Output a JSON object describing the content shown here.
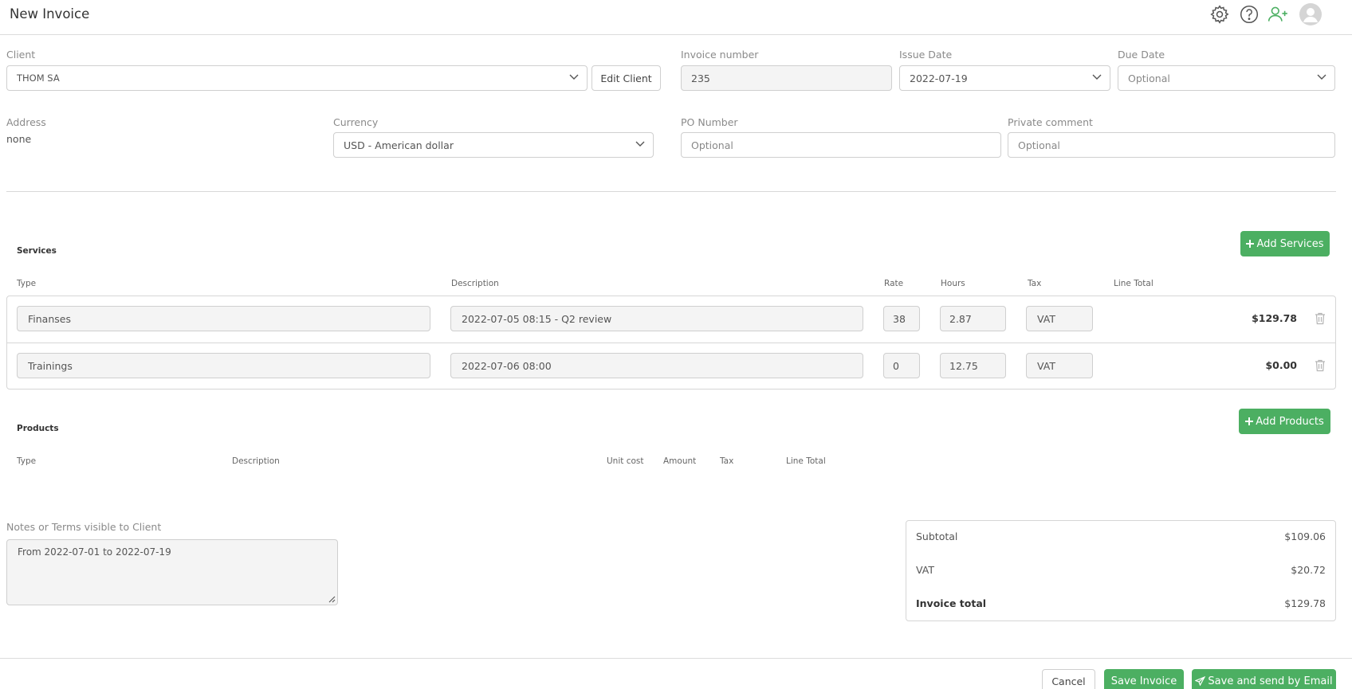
{
  "header": {
    "title": "New Invoice"
  },
  "form": {
    "client_label": "Client",
    "client_value": "THOM SA",
    "edit_client_label": "Edit Client",
    "invoice_number_label": "Invoice number",
    "invoice_number_value": "235",
    "issue_date_label": "Issue Date",
    "issue_date_value": "2022-07-19",
    "due_date_label": "Due Date",
    "due_date_placeholder": "Optional",
    "address_label": "Address",
    "address_value": "none",
    "currency_label": "Currency",
    "currency_value": "USD - American dollar",
    "po_label": "PO Number",
    "po_placeholder": "Optional",
    "private_comment_label": "Private comment",
    "private_comment_placeholder": "Optional"
  },
  "services": {
    "title": "Services",
    "add_label": "Add Services",
    "columns": [
      "Type",
      "Description",
      "Rate",
      "Hours",
      "Tax",
      "Line Total"
    ],
    "rows": [
      {
        "type": "Finanses",
        "description": "2022-07-05 08:15 - Q2 review",
        "rate": "38",
        "hours": "2.87",
        "tax": "VAT",
        "line_total": "$129.78"
      },
      {
        "type": "Trainings",
        "description": "2022-07-06 08:00",
        "rate": "0",
        "hours": "12.75",
        "tax": "VAT",
        "line_total": "$0.00"
      }
    ]
  },
  "products": {
    "title": "Products",
    "add_label": "Add Products",
    "columns": [
      "Type",
      "Description",
      "Unit cost",
      "Amount",
      "Tax",
      "Line Total"
    ]
  },
  "notes": {
    "label": "Notes or Terms visible to Client",
    "value": "From 2022-07-01 to 2022-07-19"
  },
  "totals": {
    "subtotal_label": "Subtotal",
    "subtotal_value": "$109.06",
    "vat_label": "VAT",
    "vat_value": "$20.72",
    "total_label": "Invoice total",
    "total_value": "$129.78"
  },
  "footer": {
    "cancel_label": "Cancel",
    "save_label": "Save Invoice",
    "save_send_label": "Save and send by Email"
  },
  "colors": {
    "accent_green": "#4caf62",
    "border": "#cfcfcf",
    "field_bg": "#f4f4f4"
  },
  "icons": [
    "gear-icon",
    "help-icon",
    "add-user-icon",
    "avatar",
    "chevron-down-icon",
    "plus-icon",
    "trash-icon",
    "send-icon"
  ]
}
